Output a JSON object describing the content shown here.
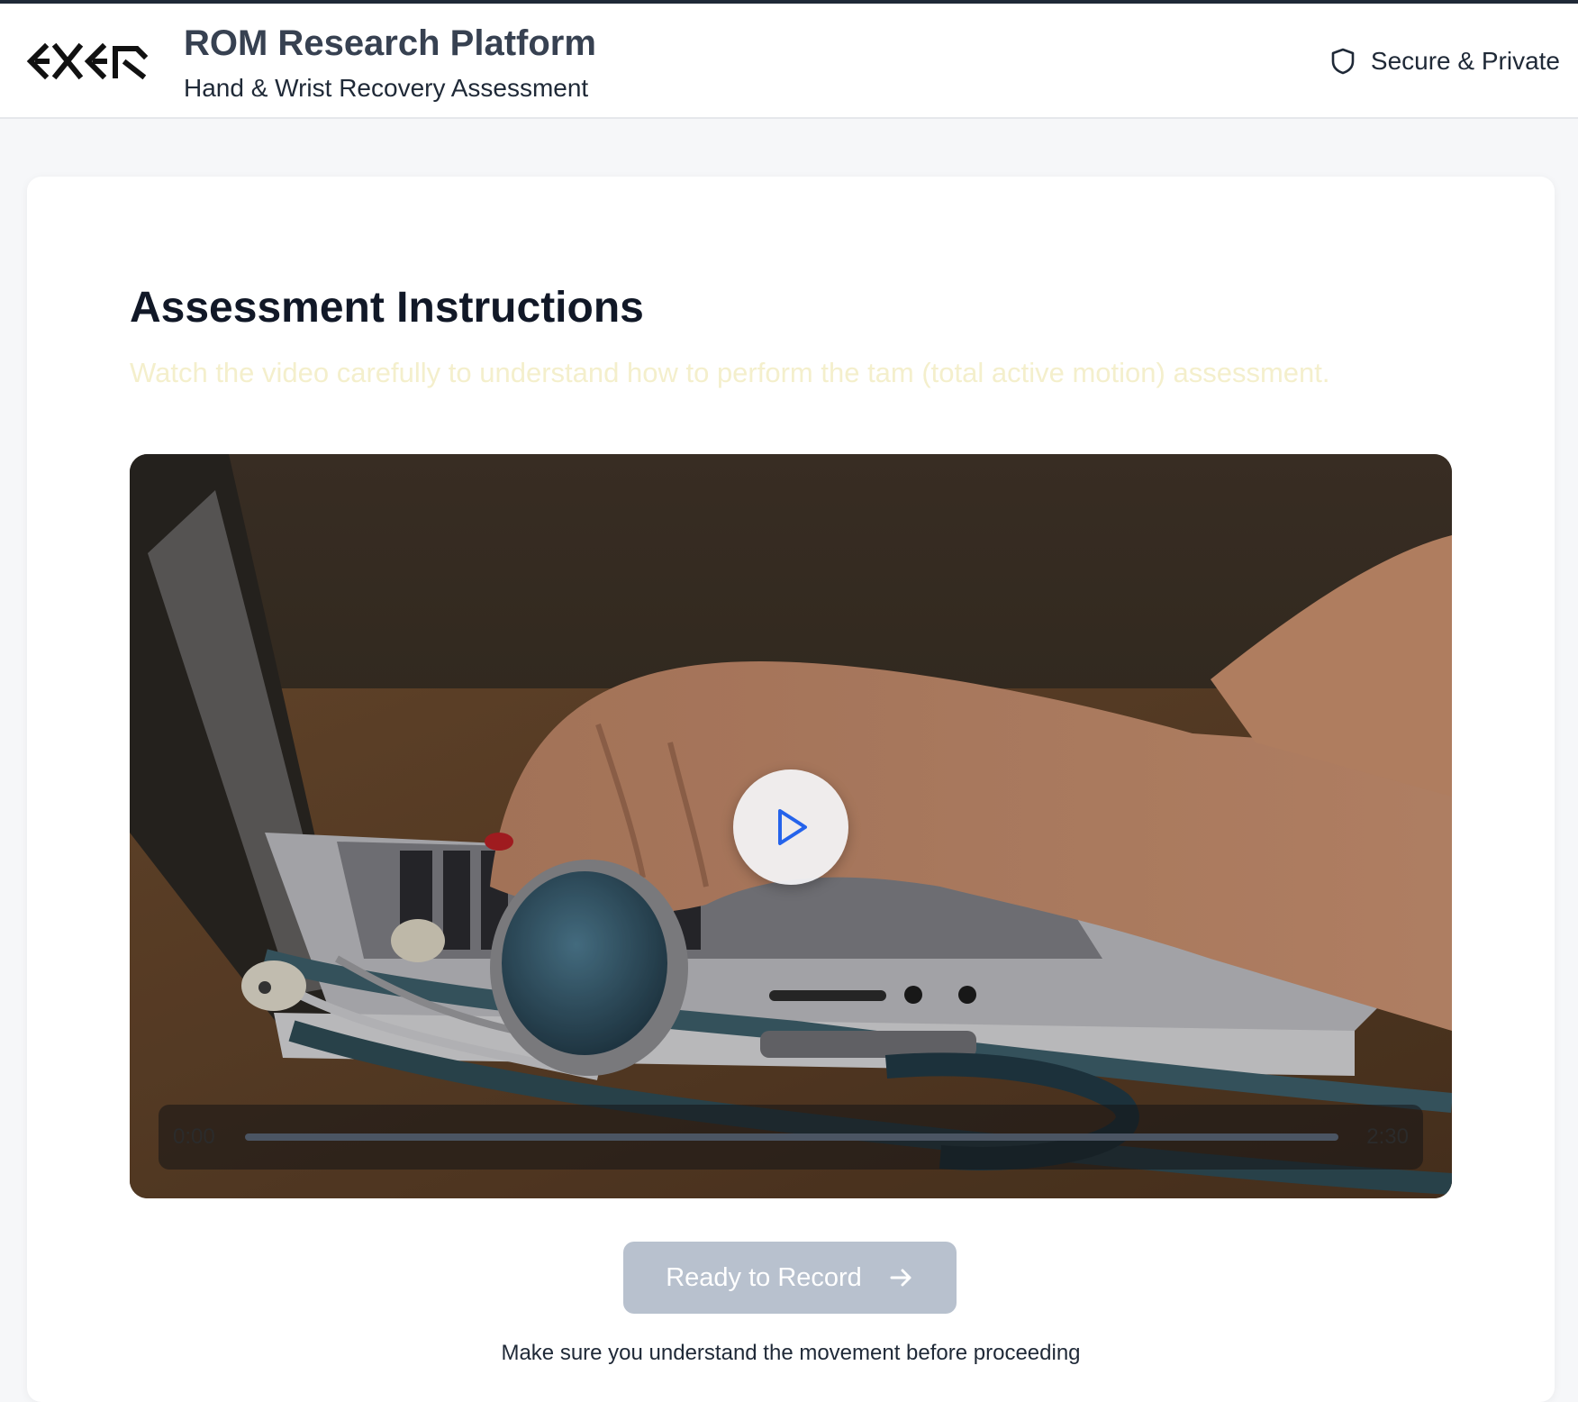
{
  "header": {
    "logo_text": "EXER",
    "title": "ROM Research Platform",
    "subtitle": "Hand & Wrist Recovery Assessment",
    "secure_label": "Secure & Private",
    "secure_icon": "shield-icon"
  },
  "main": {
    "heading": "Assessment Instructions",
    "instruction": "Watch the video carefully to understand how to perform the tam (total active motion) assessment.",
    "video": {
      "play_icon": "play-icon",
      "current_time": "0:00",
      "duration": "2:30",
      "progress": 0
    },
    "ready_button": {
      "label": "Ready to Record",
      "icon": "arrow-right-icon",
      "disabled": true
    },
    "hint": "Make sure you understand the movement before proceeding"
  },
  "colors": {
    "accent": "#2563eb",
    "button_disabled": "#b8c1ce",
    "instruction_text": "#f4efcc"
  }
}
